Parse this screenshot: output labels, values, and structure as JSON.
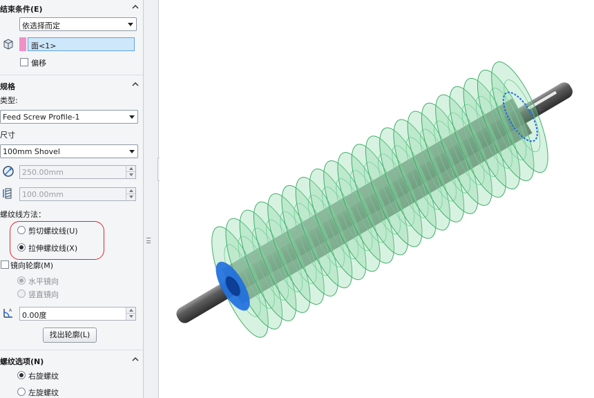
{
  "end_condition": {
    "title": "结束条件(E)",
    "mode_value": "依选择而定",
    "face_value": "面<1>",
    "offset_label": "偏移"
  },
  "spec": {
    "title": "规格",
    "type_label": "类型:",
    "type_value": "Feed Screw Profile-1",
    "size_label": "尺寸",
    "size_value": "100mm Shovel",
    "diameter_value": "250.00mm",
    "pitch_value": "100.00mm"
  },
  "thread_method": {
    "label": "螺纹线方法：",
    "options": [
      "剪切螺纹线(U)",
      "拉伸螺纹线(X)"
    ],
    "selected_index": 1
  },
  "mirror": {
    "label": "镜向轮廓(M)",
    "options": [
      "水平镜向",
      "竖直镜向"
    ],
    "angle_value": "0.00度",
    "find_profile_button": "找出轮廓(L)"
  },
  "thread_options": {
    "title": "螺纹选项(N)",
    "options": [
      "右旋螺纹",
      "左旋螺纹"
    ],
    "selected_index": 0
  },
  "colors": {
    "accent_face": "#f090c8",
    "highlight": "#e2252b",
    "thread_green": "#8fd9a8",
    "selected_blue": "#1e6ee0",
    "shaft_gray": "#4a4a4a"
  }
}
